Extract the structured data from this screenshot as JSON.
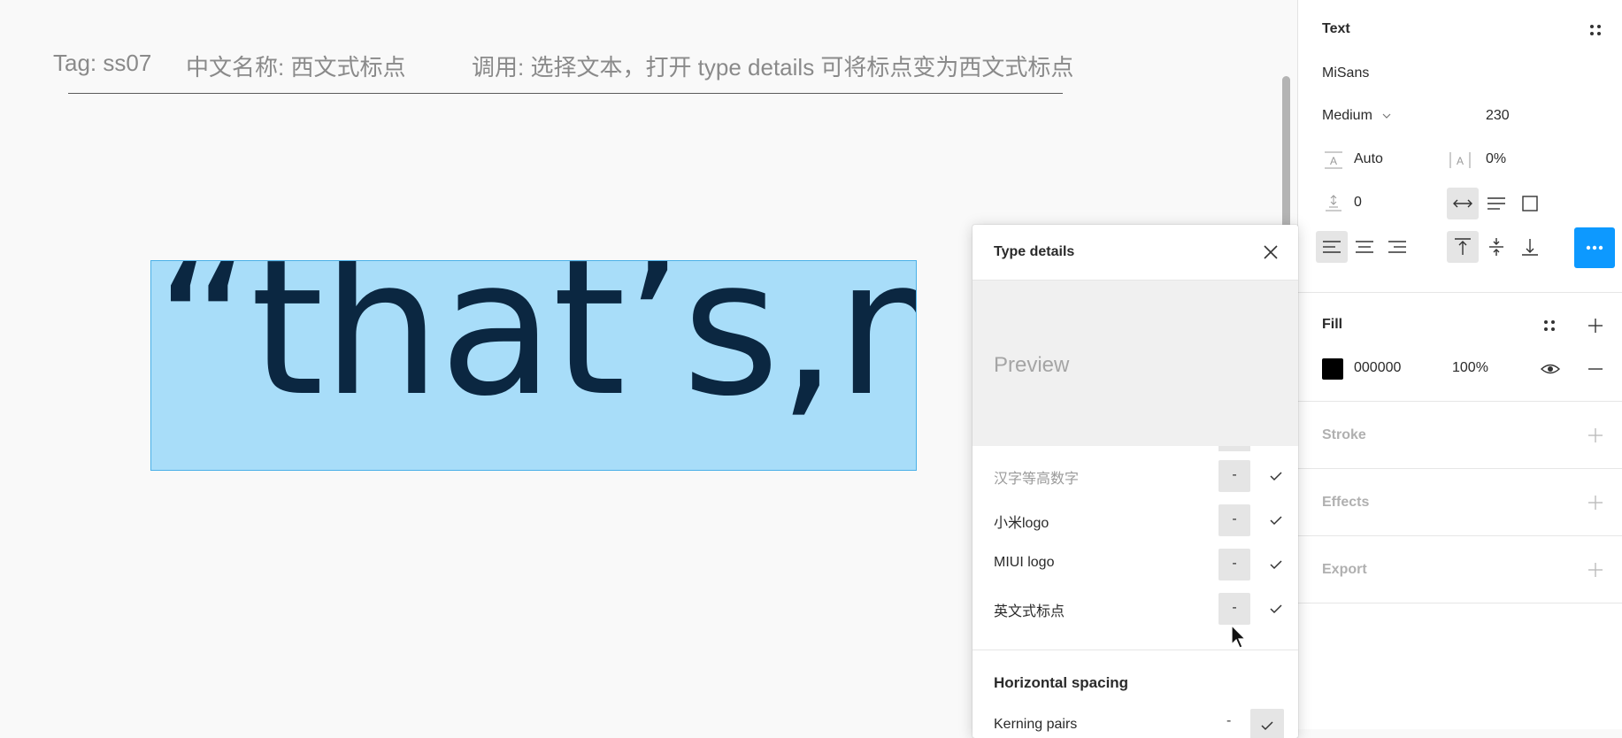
{
  "canvas": {
    "header": {
      "tag": "Tag: ss07",
      "cn_name": "中文名称: 西文式标点",
      "usage": "调用: 选择文本，打开 type details 可将标点变为西文式标点"
    },
    "sample_text": "“that’s,me"
  },
  "type_details": {
    "title": "Type details",
    "preview_label": "Preview",
    "features": [
      {
        "label": "汉字等高数字",
        "dash": "-",
        "dimmed": true
      },
      {
        "label": "小米logo",
        "dash": "-",
        "dimmed": false
      },
      {
        "label": "MIUI logo",
        "dash": "-",
        "dimmed": false
      },
      {
        "label": "英文式标点",
        "dash": "-",
        "dimmed": false
      }
    ],
    "horizontal_spacing": {
      "title": "Horizontal spacing",
      "kerning_label": "Kerning pairs",
      "kerning_dash": "-"
    }
  },
  "panel": {
    "text_section": {
      "title": "Text",
      "font_family": "MiSans",
      "font_weight": "Medium",
      "font_size": "230",
      "line_height": "Auto",
      "letter_spacing": "0%",
      "paragraph_spacing": "0"
    },
    "fill_section": {
      "title": "Fill",
      "color_hex": "000000",
      "opacity": "100%",
      "swatch_color": "#000000"
    },
    "stroke_title": "Stroke",
    "effects_title": "Effects",
    "export_title": "Export"
  },
  "colors": {
    "accent": "#0d99ff",
    "selection_fill": "#a8ddf9",
    "selection_border": "#4ab0e8",
    "sample_text": "#0b2741"
  }
}
